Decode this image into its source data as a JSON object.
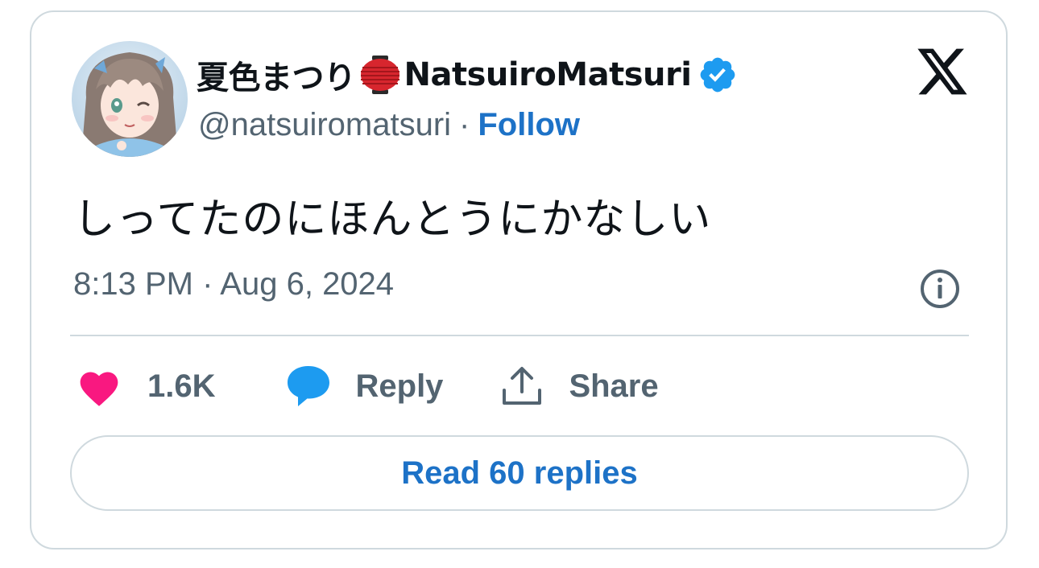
{
  "author": {
    "display_name_jp": "夏色まつり",
    "display_name_en": "NatsuiroMatsuri",
    "handle": "@natsuiromatsuri",
    "separator": "·",
    "follow_label": "Follow",
    "verified": true
  },
  "tweet": {
    "text": "しってたのにほんとうにかなしい",
    "timestamp": "8:13 PM · Aug 6, 2024"
  },
  "actions": {
    "like_count": "1.6K",
    "reply_label": "Reply",
    "share_label": "Share"
  },
  "read_replies_label": "Read 60 replies",
  "icons": {
    "logo": "x-logo-icon",
    "verified": "verified-badge-icon",
    "emoji": "red-paper-lantern-icon",
    "info": "info-icon",
    "like": "heart-icon",
    "reply": "speech-bubble-icon",
    "share": "share-upload-icon"
  },
  "colors": {
    "text": "#0f1419",
    "secondary": "#536471",
    "link": "#1d72c7",
    "border": "#cfd9de",
    "heart": "#f91880",
    "reply_bubble": "#1d9bf0",
    "verified": "#1d9bf0"
  }
}
